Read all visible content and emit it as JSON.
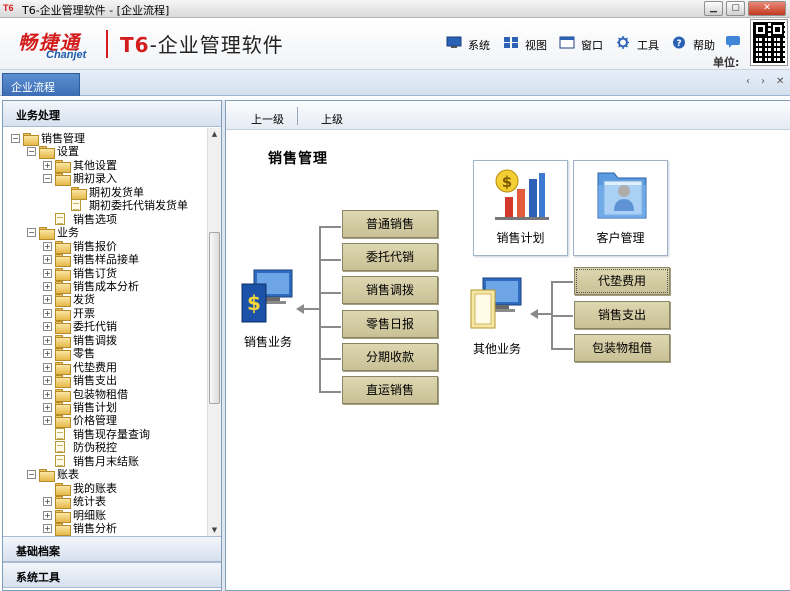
{
  "window": {
    "icon_text": "T6",
    "title": "T6-企业管理软件 - [企业流程]",
    "min_label": "▁",
    "max_label": "▢",
    "close_label": "✕"
  },
  "header": {
    "logo_cn": "畅捷通",
    "logo_en": "Chanjet",
    "product_t6": "T6",
    "product_rest": "-企业管理软件",
    "tools": [
      {
        "label": "系统",
        "icon": "system-icon"
      },
      {
        "label": "视图",
        "icon": "view-icon"
      },
      {
        "label": "窗口",
        "icon": "window-icon"
      },
      {
        "label": "工具",
        "icon": "tools-icon"
      },
      {
        "label": "帮助",
        "icon": "help-icon"
      }
    ],
    "unit_label": "单位:"
  },
  "tabbar": {
    "tab_label": "企业流程",
    "nav_prev": "‹",
    "nav_next": "›",
    "nav_close": "✕"
  },
  "left_panel": {
    "header": "业务处理",
    "tree": [
      {
        "label": "销售管理",
        "level": 0,
        "type": "folder",
        "expander": "−"
      },
      {
        "label": "设置",
        "level": 1,
        "type": "folder",
        "expander": "−"
      },
      {
        "label": "其他设置",
        "level": 2,
        "type": "folder",
        "expander": "+"
      },
      {
        "label": "期初录入",
        "level": 2,
        "type": "folder",
        "expander": "−"
      },
      {
        "label": "期初发货单",
        "level": 3,
        "type": "folder",
        "expander": ""
      },
      {
        "label": "期初委托代销发货单",
        "level": 3,
        "type": "doc",
        "expander": ""
      },
      {
        "label": "销售选项",
        "level": 2,
        "type": "doc",
        "expander": ""
      },
      {
        "label": "业务",
        "level": 1,
        "type": "folder",
        "expander": "−"
      },
      {
        "label": "销售报价",
        "level": 2,
        "type": "folder",
        "expander": "+"
      },
      {
        "label": "销售样品接单",
        "level": 2,
        "type": "folder",
        "expander": "+"
      },
      {
        "label": "销售订货",
        "level": 2,
        "type": "folder",
        "expander": "+"
      },
      {
        "label": "销售成本分析",
        "level": 2,
        "type": "folder",
        "expander": "+"
      },
      {
        "label": "发货",
        "level": 2,
        "type": "folder",
        "expander": "+"
      },
      {
        "label": "开票",
        "level": 2,
        "type": "folder",
        "expander": "+"
      },
      {
        "label": "委托代销",
        "level": 2,
        "type": "folder",
        "expander": "+"
      },
      {
        "label": "销售调拨",
        "level": 2,
        "type": "folder",
        "expander": "+"
      },
      {
        "label": "零售",
        "level": 2,
        "type": "folder",
        "expander": "+"
      },
      {
        "label": "代垫费用",
        "level": 2,
        "type": "folder",
        "expander": "+"
      },
      {
        "label": "销售支出",
        "level": 2,
        "type": "folder",
        "expander": "+"
      },
      {
        "label": "包装物租借",
        "level": 2,
        "type": "folder",
        "expander": "+"
      },
      {
        "label": "销售计划",
        "level": 2,
        "type": "folder",
        "expander": "+"
      },
      {
        "label": "价格管理",
        "level": 2,
        "type": "folder",
        "expander": "+"
      },
      {
        "label": "销售现存量查询",
        "level": 2,
        "type": "doc",
        "expander": ""
      },
      {
        "label": "防伪税控",
        "level": 2,
        "type": "doc",
        "expander": ""
      },
      {
        "label": "销售月末结账",
        "level": 2,
        "type": "doc",
        "expander": ""
      },
      {
        "label": "账表",
        "level": 1,
        "type": "folder",
        "expander": "−"
      },
      {
        "label": "我的账表",
        "level": 2,
        "type": "folder",
        "expander": ""
      },
      {
        "label": "统计表",
        "level": 2,
        "type": "folder",
        "expander": "+"
      },
      {
        "label": "明细账",
        "level": 2,
        "type": "folder",
        "expander": "+"
      },
      {
        "label": "销售分析",
        "level": 2,
        "type": "folder",
        "expander": "+"
      }
    ],
    "sections": [
      "基础档案",
      "系统工具"
    ]
  },
  "main": {
    "toolbar": {
      "up_one": "上一级",
      "up": "上级"
    },
    "title": "销售管理",
    "sales_business_label": "销售业务",
    "sales_buttons": [
      "普通销售",
      "委托代销",
      "销售调拨",
      "零售日报",
      "分期收款",
      "直运销售"
    ],
    "other_business_label": "其他业务",
    "other_buttons": [
      "代垫费用",
      "销售支出",
      "包装物租借"
    ],
    "cards": [
      {
        "label": "销售计划",
        "icon": "bar-chart-dollar-icon"
      },
      {
        "label": "客户管理",
        "icon": "customer-folder-icon"
      }
    ]
  }
}
